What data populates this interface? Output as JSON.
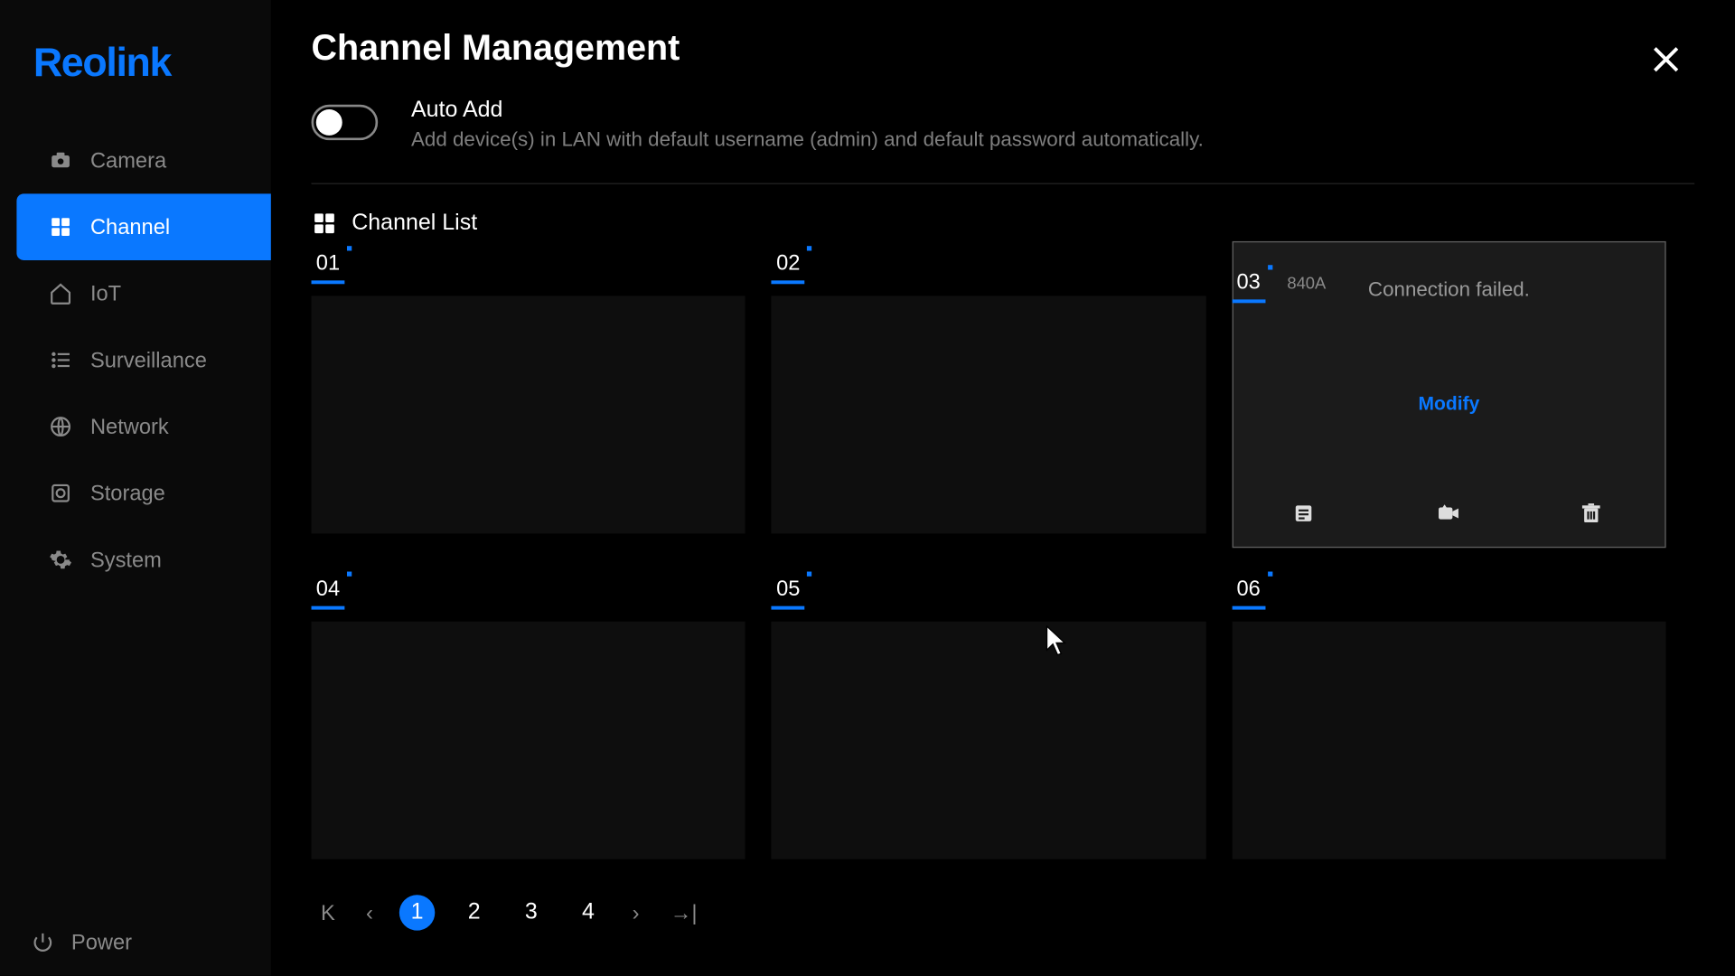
{
  "brand": "Reolink",
  "sidebar": {
    "items": [
      {
        "label": "Camera",
        "icon": "camera-icon"
      },
      {
        "label": "Channel",
        "icon": "grid-icon",
        "active": true
      },
      {
        "label": "IoT",
        "icon": "home-icon"
      },
      {
        "label": "Surveillance",
        "icon": "list-icon"
      },
      {
        "label": "Network",
        "icon": "globe-icon"
      },
      {
        "label": "Storage",
        "icon": "disk-icon"
      },
      {
        "label": "System",
        "icon": "gear-icon"
      }
    ],
    "power_label": "Power"
  },
  "page": {
    "title": "Channel Management",
    "autoadd": {
      "title": "Auto Add",
      "description": "Add device(s) in LAN with default username (admin) and default password automatically.",
      "enabled": false
    },
    "channel_list_label": "Channel List",
    "cells": [
      {
        "num": "01"
      },
      {
        "num": "02"
      },
      {
        "num": "03",
        "name": "840A",
        "status": "Connection failed.",
        "action_label": "Modify",
        "active": true
      },
      {
        "num": "04"
      },
      {
        "num": "05"
      },
      {
        "num": "06"
      }
    ],
    "pagination": {
      "pages": [
        "1",
        "2",
        "3",
        "4"
      ],
      "current": "1"
    }
  }
}
